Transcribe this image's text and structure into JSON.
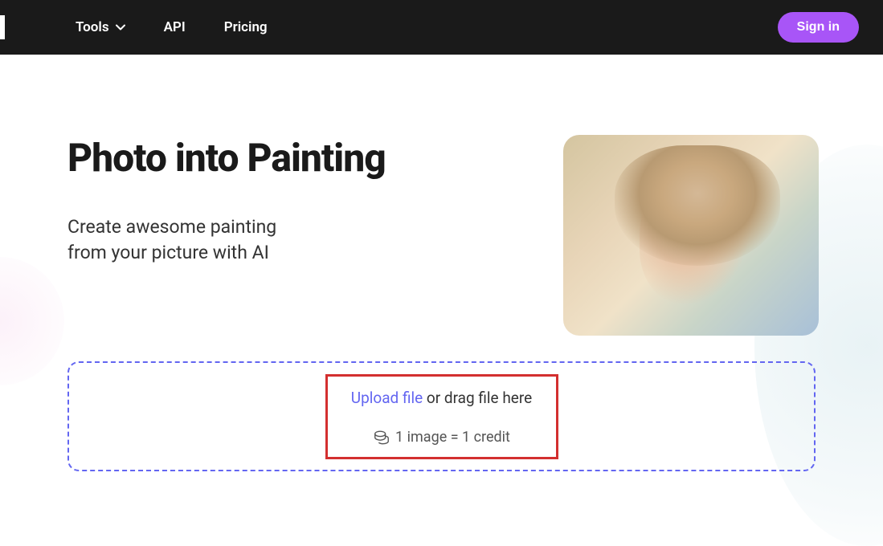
{
  "nav": {
    "tools_label": "Tools",
    "api_label": "API",
    "pricing_label": "Pricing",
    "signin_label": "Sign in"
  },
  "hero": {
    "title": "Photo into Painting",
    "subtitle_line1": "Create awesome painting",
    "subtitle_line2": "from your picture with AI"
  },
  "upload": {
    "link_text": "Upload file",
    "drag_text": " or drag file here",
    "credit_text": "1 image = 1 credit"
  }
}
